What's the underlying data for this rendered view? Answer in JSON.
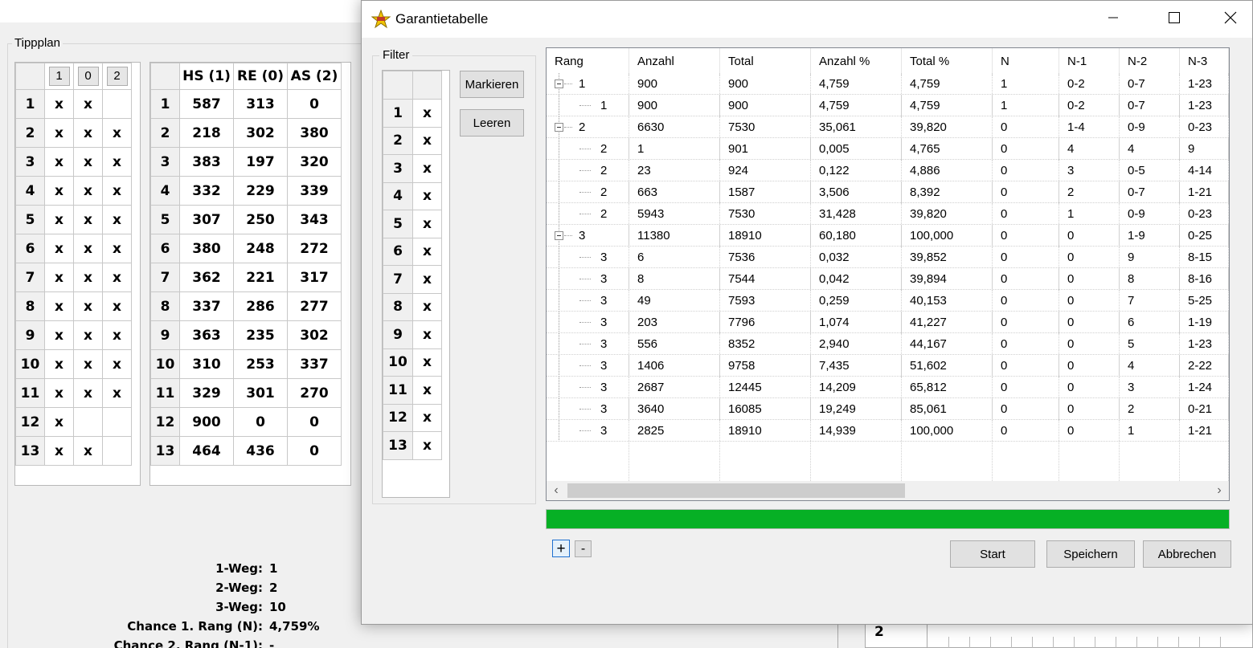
{
  "background": {
    "group_title": "Tippplan",
    "tipp_header": [
      "1",
      "0",
      "2"
    ],
    "tipp_rows": [
      {
        "n": "1",
        "c": [
          "x",
          "x",
          ""
        ]
      },
      {
        "n": "2",
        "c": [
          "x",
          "x",
          "x"
        ]
      },
      {
        "n": "3",
        "c": [
          "x",
          "x",
          "x"
        ]
      },
      {
        "n": "4",
        "c": [
          "x",
          "x",
          "x"
        ]
      },
      {
        "n": "5",
        "c": [
          "x",
          "x",
          "x"
        ]
      },
      {
        "n": "6",
        "c": [
          "x",
          "x",
          "x"
        ]
      },
      {
        "n": "7",
        "c": [
          "x",
          "x",
          "x"
        ]
      },
      {
        "n": "8",
        "c": [
          "x",
          "x",
          "x"
        ]
      },
      {
        "n": "9",
        "c": [
          "x",
          "x",
          "x"
        ]
      },
      {
        "n": "10",
        "c": [
          "x",
          "x",
          "x"
        ]
      },
      {
        "n": "11",
        "c": [
          "x",
          "x",
          "x"
        ]
      },
      {
        "n": "12",
        "c": [
          "x",
          "",
          ""
        ]
      },
      {
        "n": "13",
        "c": [
          "x",
          "x",
          ""
        ]
      }
    ],
    "stats_header": [
      "HS (1)",
      "RE (0)",
      "AS (2)"
    ],
    "stats_rows": [
      {
        "n": "1",
        "c": [
          "587",
          "313",
          "0"
        ]
      },
      {
        "n": "2",
        "c": [
          "218",
          "302",
          "380"
        ]
      },
      {
        "n": "3",
        "c": [
          "383",
          "197",
          "320"
        ]
      },
      {
        "n": "4",
        "c": [
          "332",
          "229",
          "339"
        ]
      },
      {
        "n": "5",
        "c": [
          "307",
          "250",
          "343"
        ]
      },
      {
        "n": "6",
        "c": [
          "380",
          "248",
          "272"
        ]
      },
      {
        "n": "7",
        "c": [
          "362",
          "221",
          "317"
        ]
      },
      {
        "n": "8",
        "c": [
          "337",
          "286",
          "277"
        ]
      },
      {
        "n": "9",
        "c": [
          "363",
          "235",
          "302"
        ]
      },
      {
        "n": "10",
        "c": [
          "310",
          "253",
          "337"
        ]
      },
      {
        "n": "11",
        "c": [
          "329",
          "301",
          "270"
        ]
      },
      {
        "n": "12",
        "c": [
          "900",
          "0",
          "0"
        ]
      },
      {
        "n": "13",
        "c": [
          "464",
          "436",
          "0"
        ]
      }
    ],
    "summary": [
      {
        "label": "1-Weg:",
        "value": "1"
      },
      {
        "label": "2-Weg:",
        "value": "2"
      },
      {
        "label": "3-Weg:",
        "value": "10"
      },
      {
        "label": "Chance 1. Rang (N):",
        "value": "4,759%"
      },
      {
        "label": "Chance 2. Rang (N-1):",
        "value": "-"
      }
    ],
    "bottom_cell": "2"
  },
  "dialog": {
    "title": "Garantietabelle",
    "filter": {
      "title": "Filter",
      "rows": [
        {
          "n": "1",
          "v": "x"
        },
        {
          "n": "2",
          "v": "x"
        },
        {
          "n": "3",
          "v": "x"
        },
        {
          "n": "4",
          "v": "x"
        },
        {
          "n": "5",
          "v": "x"
        },
        {
          "n": "6",
          "v": "x"
        },
        {
          "n": "7",
          "v": "x"
        },
        {
          "n": "8",
          "v": "x"
        },
        {
          "n": "9",
          "v": "x"
        },
        {
          "n": "10",
          "v": "x"
        },
        {
          "n": "11",
          "v": "x"
        },
        {
          "n": "12",
          "v": "x"
        },
        {
          "n": "13",
          "v": "x"
        }
      ],
      "markieren_label": "Markieren",
      "leeren_label": "Leeren"
    },
    "table": {
      "columns": [
        "Rang",
        "Anzahl",
        "Total",
        "Anzahl %",
        "Total %",
        "N",
        "N-1",
        "N-2",
        "N-3"
      ],
      "rows": [
        {
          "level": 0,
          "c": [
            "1",
            "900",
            "900",
            "4,759",
            "4,759",
            "1",
            "0-2",
            "0-7",
            "1-23"
          ]
        },
        {
          "level": 1,
          "c": [
            "1",
            "900",
            "900",
            "4,759",
            "4,759",
            "1",
            "0-2",
            "0-7",
            "1-23"
          ]
        },
        {
          "level": 0,
          "c": [
            "2",
            "6630",
            "7530",
            "35,061",
            "39,820",
            "0",
            "1-4",
            "0-9",
            "0-23"
          ]
        },
        {
          "level": 1,
          "c": [
            "2",
            "1",
            "901",
            "0,005",
            "4,765",
            "0",
            "4",
            "4",
            "9"
          ]
        },
        {
          "level": 1,
          "c": [
            "2",
            "23",
            "924",
            "0,122",
            "4,886",
            "0",
            "3",
            "0-5",
            "4-14"
          ]
        },
        {
          "level": 1,
          "c": [
            "2",
            "663",
            "1587",
            "3,506",
            "8,392",
            "0",
            "2",
            "0-7",
            "1-21"
          ]
        },
        {
          "level": 1,
          "c": [
            "2",
            "5943",
            "7530",
            "31,428",
            "39,820",
            "0",
            "1",
            "0-9",
            "0-23"
          ]
        },
        {
          "level": 0,
          "c": [
            "3",
            "11380",
            "18910",
            "60,180",
            "100,000",
            "0",
            "0",
            "1-9",
            "0-25"
          ]
        },
        {
          "level": 1,
          "c": [
            "3",
            "6",
            "7536",
            "0,032",
            "39,852",
            "0",
            "0",
            "9",
            "8-15"
          ]
        },
        {
          "level": 1,
          "c": [
            "3",
            "8",
            "7544",
            "0,042",
            "39,894",
            "0",
            "0",
            "8",
            "8-16"
          ]
        },
        {
          "level": 1,
          "c": [
            "3",
            "49",
            "7593",
            "0,259",
            "40,153",
            "0",
            "0",
            "7",
            "5-25"
          ]
        },
        {
          "level": 1,
          "c": [
            "3",
            "203",
            "7796",
            "1,074",
            "41,227",
            "0",
            "0",
            "6",
            "1-19"
          ]
        },
        {
          "level": 1,
          "c": [
            "3",
            "556",
            "8352",
            "2,940",
            "44,167",
            "0",
            "0",
            "5",
            "1-23"
          ]
        },
        {
          "level": 1,
          "c": [
            "3",
            "1406",
            "9758",
            "7,435",
            "51,602",
            "0",
            "0",
            "4",
            "2-22"
          ]
        },
        {
          "level": 1,
          "c": [
            "3",
            "2687",
            "12445",
            "14,209",
            "65,812",
            "0",
            "0",
            "3",
            "1-24"
          ]
        },
        {
          "level": 1,
          "c": [
            "3",
            "3640",
            "16085",
            "19,249",
            "85,061",
            "0",
            "0",
            "2",
            "0-21"
          ]
        },
        {
          "level": 1,
          "c": [
            "3",
            "2825",
            "18910",
            "14,939",
            "100,000",
            "0",
            "0",
            "1",
            "1-21"
          ]
        }
      ]
    },
    "progress": 1.0,
    "progress_color": "#06b025",
    "expand_label": "+",
    "collapse_label": "-",
    "start_label": "Start",
    "speichern_label": "Speichern",
    "abbrechen_label": "Abbrechen",
    "icons": {
      "app": "star-icon",
      "minimize": "minimize-icon",
      "maximize": "maximize-icon",
      "close": "close-icon"
    }
  }
}
